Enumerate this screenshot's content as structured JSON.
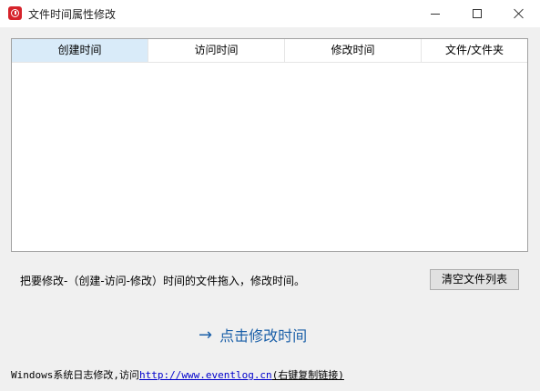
{
  "window": {
    "title": "文件时间属性修改"
  },
  "list": {
    "columns": [
      "创建时间",
      "访问时间",
      "修改时间",
      "文件/文件夹"
    ],
    "active_column": 0,
    "rows": []
  },
  "hint": "把要修改-（创建-访问-修改）时间的文件拖入，修改时间。",
  "buttons": {
    "clear": "清空文件列表"
  },
  "action": {
    "arrow": "→",
    "label": "点击修改时间"
  },
  "footer": {
    "prefix": "Windows系统日志修改,访问",
    "link_url": "http://www.eventlog.cn",
    "suffix": "(右键复制链接)"
  },
  "colors": {
    "app_icon": "#d6232b",
    "header_active": "#d9ebf9",
    "action_link": "#1a5fa8",
    "footer_link": "#0000cc"
  },
  "icons": {
    "app": "clock-icon",
    "arrow": "arrow-right-icon"
  }
}
